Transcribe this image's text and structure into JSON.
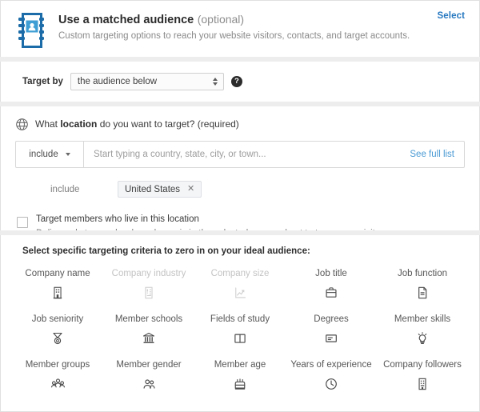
{
  "header": {
    "icon": "address-book-icon",
    "title": "Use a matched audience",
    "optional": "(optional)",
    "subtitle": "Custom targeting options to reach your website visitors, contacts, and target accounts.",
    "select_link": "Select",
    "accent_color": "#2577bf"
  },
  "target_by": {
    "label": "Target by",
    "selected": "the audience below",
    "help_icon": "question-mark-icon"
  },
  "location": {
    "icon": "globe-icon",
    "question_prefix": "What ",
    "question_bold": "location",
    "question_suffix": " do you want to target? (required)",
    "operator": "include",
    "placeholder": "Start typing a country, state, city, or town...",
    "input_value": "",
    "full_list_link": "See full list",
    "chip_label": "include",
    "chips": [
      {
        "label": "United States",
        "remove_icon": "close-icon"
      }
    ],
    "checkbox": {
      "checked": false,
      "title": "Target members who live in this location",
      "description": "Deliver ads to people whose home is in the selected area and not to temporary visitors"
    }
  },
  "criteria": {
    "title": "Select specific targeting criteria to zero in on your ideal audience:",
    "items": [
      {
        "label": "Company name",
        "icon": "building-icon",
        "disabled": false
      },
      {
        "label": "Company industry",
        "icon": "factory-icon",
        "disabled": true
      },
      {
        "label": "Company size",
        "icon": "trending-chart-icon",
        "disabled": true
      },
      {
        "label": "Job title",
        "icon": "briefcase-icon",
        "disabled": false
      },
      {
        "label": "Job function",
        "icon": "document-icon",
        "disabled": false
      },
      {
        "label": "Job seniority",
        "icon": "medal-icon",
        "disabled": false
      },
      {
        "label": "Member schools",
        "icon": "university-icon",
        "disabled": false
      },
      {
        "label": "Fields of study",
        "icon": "open-book-icon",
        "disabled": false
      },
      {
        "label": "Degrees",
        "icon": "certificate-icon",
        "disabled": false
      },
      {
        "label": "Member skills",
        "icon": "lightbulb-icon",
        "disabled": false
      },
      {
        "label": "Member groups",
        "icon": "group-people-icon",
        "disabled": false
      },
      {
        "label": "Member gender",
        "icon": "two-people-icon",
        "disabled": false
      },
      {
        "label": "Member age",
        "icon": "cake-icon",
        "disabled": false
      },
      {
        "label": "Years of experience",
        "icon": "clock-icon",
        "disabled": false
      },
      {
        "label": "Company followers",
        "icon": "office-building-icon",
        "disabled": false
      }
    ]
  }
}
